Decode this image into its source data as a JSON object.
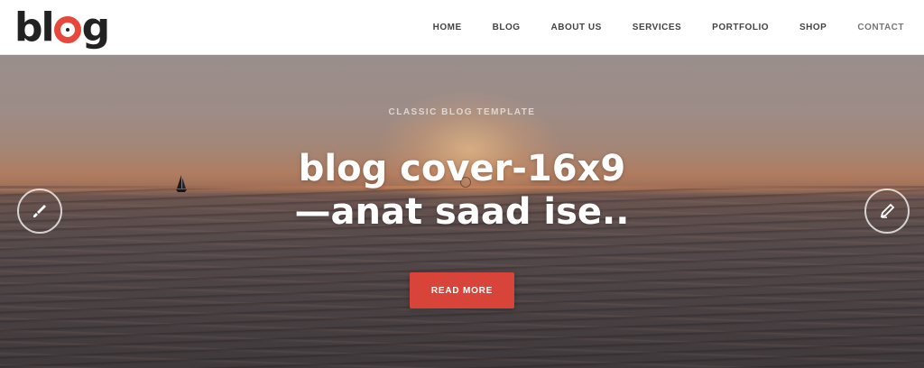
{
  "header": {
    "logo": {
      "prefix": "bl",
      "suffix": "g",
      "accent_color": "#e8473c"
    },
    "nav": [
      {
        "label": "HOME"
      },
      {
        "label": "BLOG"
      },
      {
        "label": "ABOUT US"
      },
      {
        "label": "SERVICES"
      },
      {
        "label": "PORTFOLIO"
      },
      {
        "label": "SHOP"
      },
      {
        "label": "CONTACT"
      }
    ]
  },
  "hero": {
    "kicker": "CLASSIC BLOG TEMPLATE",
    "title_line1": "blog cover-16x9",
    "title_line2": "—anat saad ise..",
    "cta_label": "READ MORE",
    "cta_color": "#d9443a",
    "prev_icon": "brush-icon",
    "next_icon": "pen-icon"
  }
}
